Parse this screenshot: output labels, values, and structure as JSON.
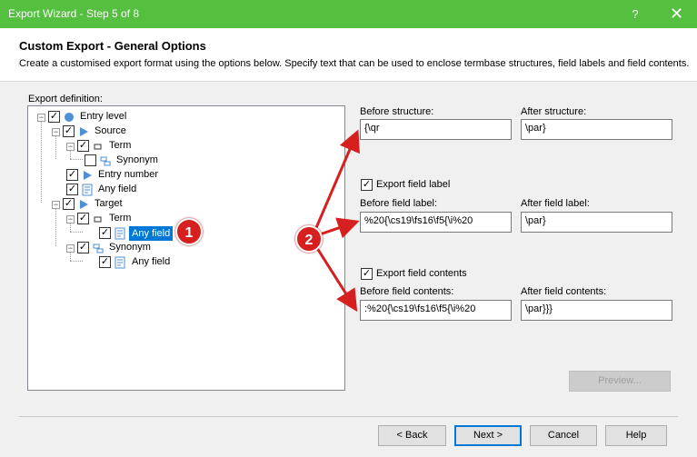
{
  "window": {
    "title": "Export Wizard - Step 5 of 8",
    "help": "?",
    "close": "✕"
  },
  "header": {
    "title": "Custom Export - General Options",
    "description": "Create a customised export format using the options below. Specify text that can be used to enclose termbase structures, field labels and field contents."
  },
  "export_definition_label": "Export definition:",
  "tree": {
    "entry_level": "Entry level",
    "source": "Source",
    "term": "Term",
    "synonym": "Synonym",
    "entry_number": "Entry number",
    "any_field": "Any field",
    "target": "Target",
    "target_term": "Term",
    "target_any_field": "Any field",
    "target_synonym": "Synonym",
    "target_synonym_any_field": "Any field"
  },
  "fields": {
    "before_structure_label": "Before structure:",
    "before_structure_value": "{\\qr",
    "after_structure_label": "After structure:",
    "after_structure_value": "\\par}",
    "export_field_label": "Export field label",
    "before_field_label_label": "Before field label:",
    "before_field_label_value": "%20{\\cs19\\fs16\\f5{\\i%20",
    "after_field_label_label": "After field label:",
    "after_field_label_value": "\\par}",
    "export_field_contents": "Export field contents",
    "before_field_contents_label": "Before field contents:",
    "before_field_contents_value": ":%20{\\cs19\\fs16\\f5{\\i%20",
    "after_field_contents_label": "After field contents:",
    "after_field_contents_value": "\\par}}}"
  },
  "buttons": {
    "preview": "Preview...",
    "back": "< Back",
    "next": "Next >",
    "cancel": "Cancel",
    "help": "Help"
  },
  "annotations": {
    "badge1": "1",
    "badge2": "2",
    "color": "#d62020"
  },
  "colors": {
    "titlebar": "#55bf3f",
    "selection": "#0078d7",
    "icon_blue": "#4f8fd6"
  }
}
